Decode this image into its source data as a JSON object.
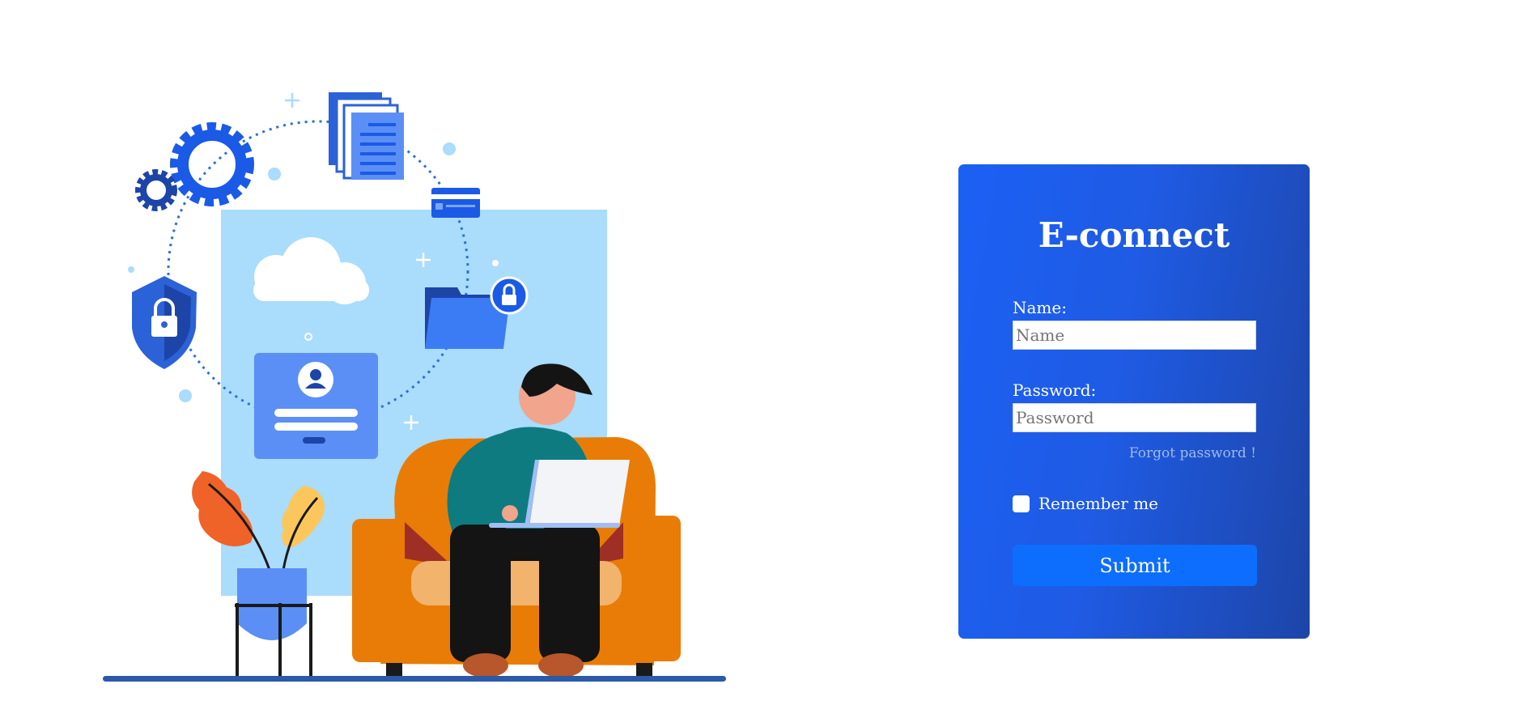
{
  "illustration": {
    "alt": "Person working on a laptop with security icons",
    "icons": [
      "gear-icon",
      "document-icon",
      "credit-card-icon",
      "cloud-icon",
      "folder-lock-icon",
      "shield-lock-icon",
      "user-profile-icon",
      "plant-icon",
      "armchair-icon",
      "laptop-icon"
    ]
  },
  "login": {
    "title": "E-connect",
    "name_label": "Name:",
    "name_placeholder": "Name",
    "name_value": "",
    "password_label": "Password:",
    "password_placeholder": "Password",
    "password_value": "",
    "forgot_label": "Forgot password !",
    "remember_label": "Remember me",
    "remember_checked": false,
    "submit_label": "Submit"
  },
  "colors": {
    "card_gradient_start": "#1b60f4",
    "card_gradient_end": "#1d45a8",
    "submit_button": "#0d6efd",
    "forgot_link": "#9fb9ef",
    "illustration_backdrop": "#aadcfb",
    "armchair": "#e97c06",
    "accent_blue": "#1a5ae6"
  }
}
